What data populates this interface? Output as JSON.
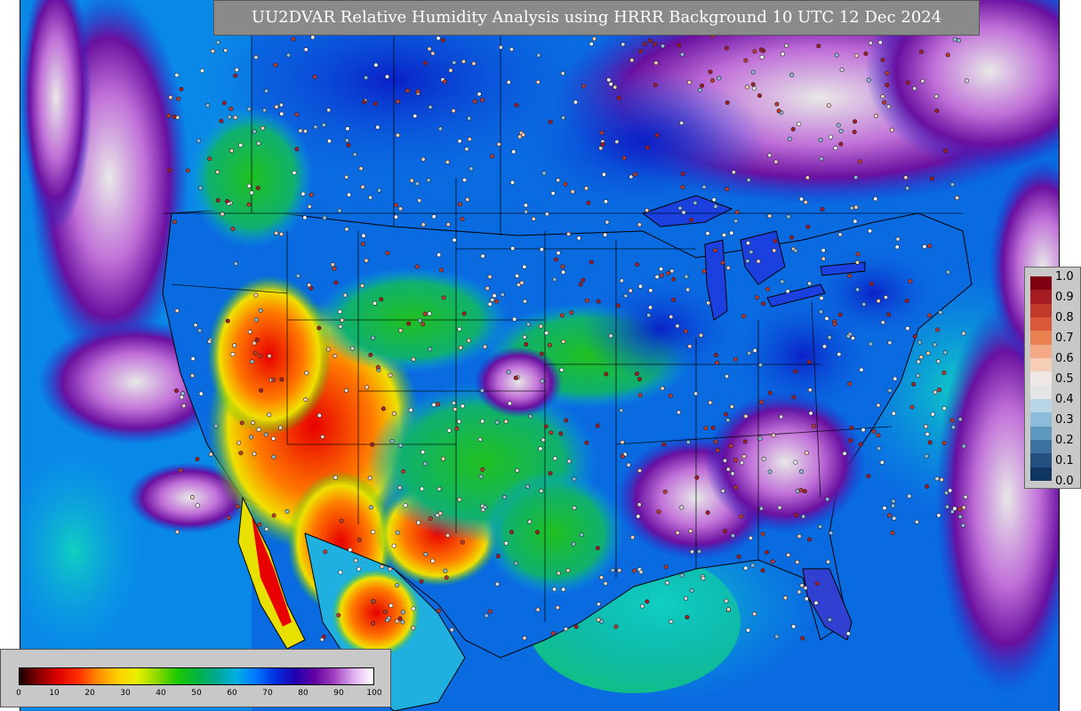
{
  "title": "UU2DVAR Relative Humidity Analysis using HRRR Background 10 UTC 12 Dec 2024",
  "weight_legend": {
    "labels": [
      "1.0",
      "0.9",
      "0.8",
      "0.7",
      "0.6",
      "0.5",
      "0.4",
      "0.3",
      "0.2",
      "0.1",
      "0.0"
    ],
    "colors": [
      "#7f0010",
      "#a51c22",
      "#c0392b",
      "#d9583a",
      "#e8804f",
      "#f3a986",
      "#f6cdb5",
      "#f0e8e4",
      "#e5e5e5",
      "#b9d6e6",
      "#8cbcd8",
      "#5f98bf",
      "#3d73a3",
      "#23517f",
      "#0f3560"
    ]
  },
  "rh_legend": {
    "ticks": [
      "0",
      "10",
      "20",
      "30",
      "40",
      "50",
      "60",
      "70",
      "80",
      "90",
      "100"
    ],
    "colors": [
      "#1a0000",
      "#8b0000",
      "#e00000",
      "#ff3000",
      "#ff8c00",
      "#ffd000",
      "#e8f000",
      "#8cd800",
      "#1fc800",
      "#00b43c",
      "#00a890",
      "#00b0e0",
      "#0078ff",
      "#0030e0",
      "#2000b0",
      "#6000a0",
      "#a040c0",
      "#e0b0f0",
      "#ffffff"
    ]
  },
  "colors": {
    "ocean_deep": "#0a3fd8",
    "ocean_mid": "#0aa0e8",
    "moist": "#d4d4d4",
    "very_moist": "#7a0a9a",
    "dry_red": "#e80000",
    "dry_yellow": "#f0e000",
    "green": "#20c020"
  }
}
